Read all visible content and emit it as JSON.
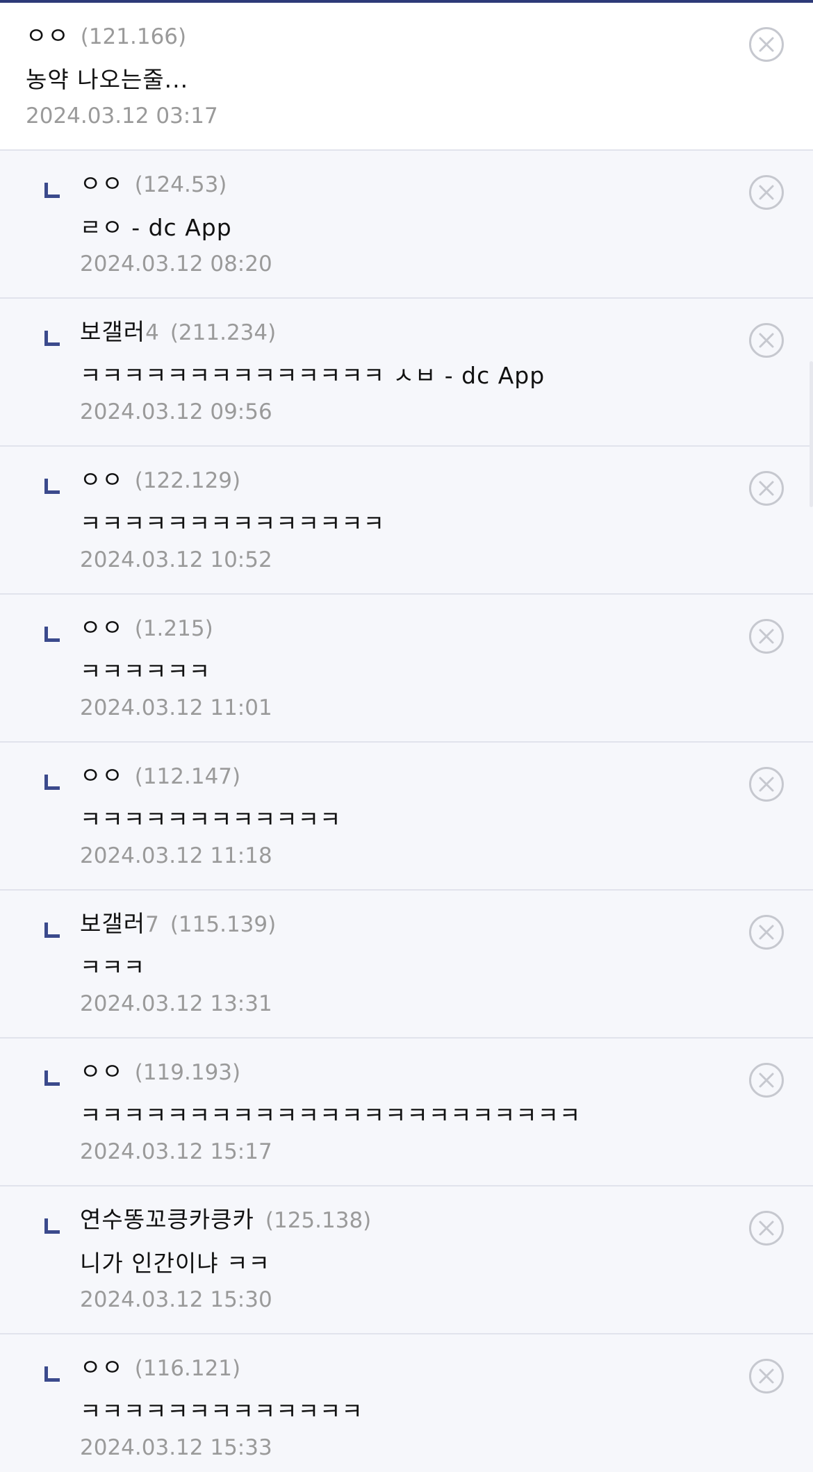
{
  "icons": {
    "close": "circle-x-icon",
    "reply": "reply-corner-icon"
  },
  "colors": {
    "accent": "#2d3a78",
    "reply_mark": "#3b4a8c",
    "muted_text": "#9a9a9a",
    "close_icon": "#c6c8cf"
  },
  "comments": [
    {
      "nick": "ㅇㅇ",
      "nick_suffix": "",
      "ip": "(121.166)",
      "text": "농약 나오는줄...",
      "date": "2024.03.12 03:17"
    },
    {
      "nick": "ㅇㅇ",
      "nick_suffix": "",
      "ip": "(124.53)",
      "text": "ㄹㅇ - dc App",
      "date": "2024.03.12 08:20"
    },
    {
      "nick": "보갤러",
      "nick_suffix": "4",
      "ip": "(211.234)",
      "text": "ㅋㅋㅋㅋㅋㅋㅋㅋㅋㅋㅋㅋㅋㅋ ㅅㅂ - dc App",
      "date": "2024.03.12 09:56"
    },
    {
      "nick": "ㅇㅇ",
      "nick_suffix": "",
      "ip": "(122.129)",
      "text": "ㅋㅋㅋㅋㅋㅋㅋㅋㅋㅋㅋㅋㅋㅋ",
      "date": "2024.03.12 10:52"
    },
    {
      "nick": "ㅇㅇ",
      "nick_suffix": "",
      "ip": "(1.215)",
      "text": "ㅋㅋㅋㅋㅋㅋ",
      "date": "2024.03.12 11:01"
    },
    {
      "nick": "ㅇㅇ",
      "nick_suffix": "",
      "ip": "(112.147)",
      "text": "ㅋㅋㅋㅋㅋㅋㅋㅋㅋㅋㅋㅋ",
      "date": "2024.03.12 11:18"
    },
    {
      "nick": "보갤러",
      "nick_suffix": "7",
      "ip": "(115.139)",
      "text": "ㅋㅋㅋ",
      "date": "2024.03.12 13:31"
    },
    {
      "nick": "ㅇㅇ",
      "nick_suffix": "",
      "ip": "(119.193)",
      "text": "ㅋㅋㅋㅋㅋㅋㅋㅋㅋㅋㅋㅋㅋㅋㅋㅋㅋㅋㅋㅋㅋㅋㅋ",
      "date": "2024.03.12 15:17"
    },
    {
      "nick": "연수똥꼬킁카킁카",
      "nick_suffix": "",
      "ip": "(125.138)",
      "text": "니가 인간이냐 ㅋㅋ",
      "date": "2024.03.12 15:30"
    },
    {
      "nick": "ㅇㅇ",
      "nick_suffix": "",
      "ip": "(116.121)",
      "text": "ㅋㅋㅋㅋㅋㅋㅋㅋㅋㅋㅋㅋㅋ",
      "date": "2024.03.12 15:33"
    }
  ]
}
